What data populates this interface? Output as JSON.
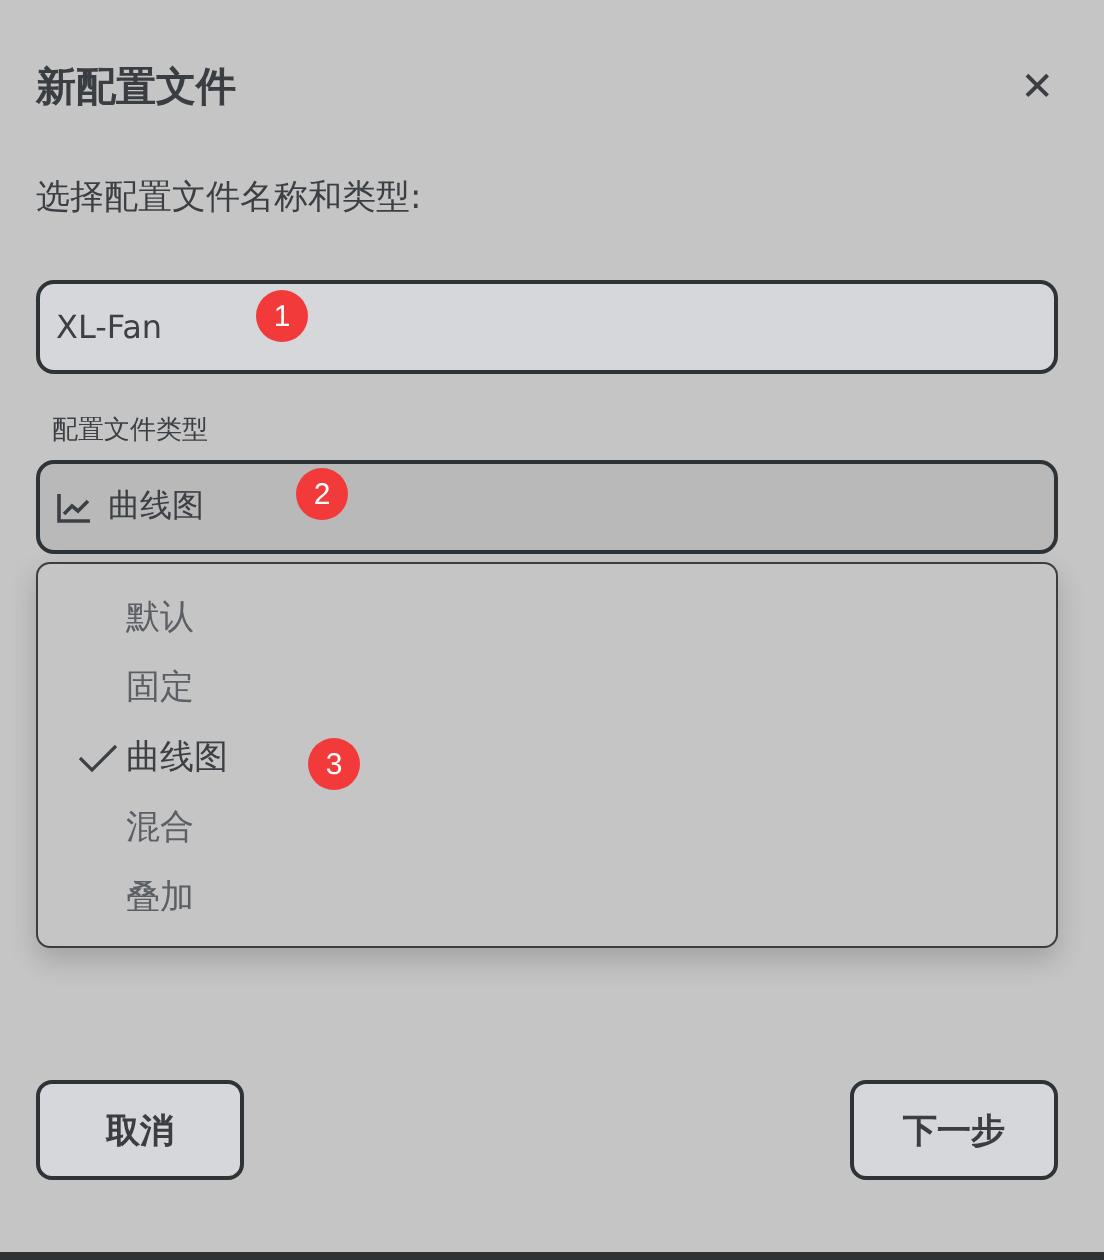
{
  "dialog": {
    "title": "新配置文件",
    "close": "✕"
  },
  "prompt": "选择配置文件名称和类型:",
  "name_field": {
    "value": "XL-Fan",
    "marker": "1"
  },
  "type_select": {
    "label": "配置文件类型",
    "value": "曲线图",
    "marker": "2",
    "expanded": true
  },
  "dropdown": {
    "marker": "3",
    "options": [
      {
        "label": "默认",
        "selected": false
      },
      {
        "label": "固定",
        "selected": false
      },
      {
        "label": "曲线图",
        "selected": true
      },
      {
        "label": "混合",
        "selected": false
      },
      {
        "label": "叠加",
        "selected": false
      }
    ]
  },
  "buttons": [
    {
      "label": "取消",
      "kind": "cancel"
    },
    {
      "label": "下一步",
      "kind": "next"
    }
  ]
}
